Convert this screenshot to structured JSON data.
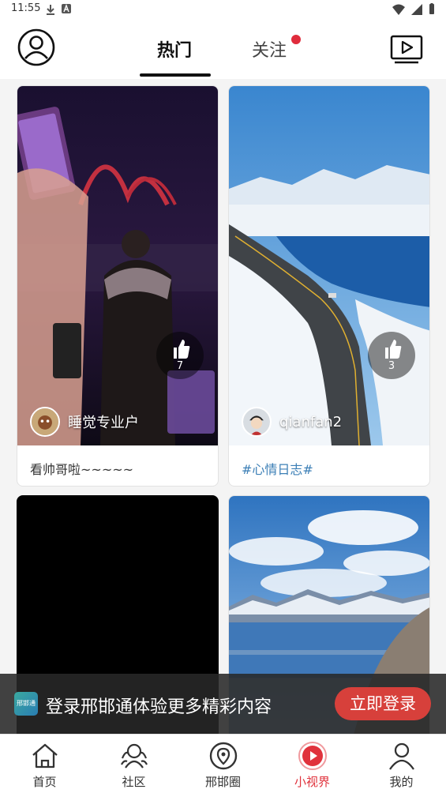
{
  "status_bar": {
    "time": "11:55"
  },
  "tabs": {
    "hot": "热门",
    "follow": "关注"
  },
  "cards": [
    {
      "author": "睡觉专业户",
      "likes": "7",
      "caption": "看帅哥啦~~~~~"
    },
    {
      "author": "qianfan2",
      "likes": "3",
      "caption": "#心情日志#"
    }
  ],
  "login_banner": {
    "logo_text": "邢邯通",
    "message": "登录邢邯通体验更多精彩内容",
    "button": "立即登录"
  },
  "bottom_nav": {
    "items": [
      {
        "label": "首页",
        "icon": "home-icon"
      },
      {
        "label": "社区",
        "icon": "community-icon"
      },
      {
        "label": "邢邯圈",
        "icon": "location-circle-icon"
      },
      {
        "label": "小视界",
        "icon": "play-circle-icon"
      },
      {
        "label": "我的",
        "icon": "user-icon"
      }
    ],
    "active_index": 3
  },
  "colors": {
    "accent": "#e0323c",
    "login_button": "#d7403b",
    "hashtag": "#3c7fb6"
  }
}
